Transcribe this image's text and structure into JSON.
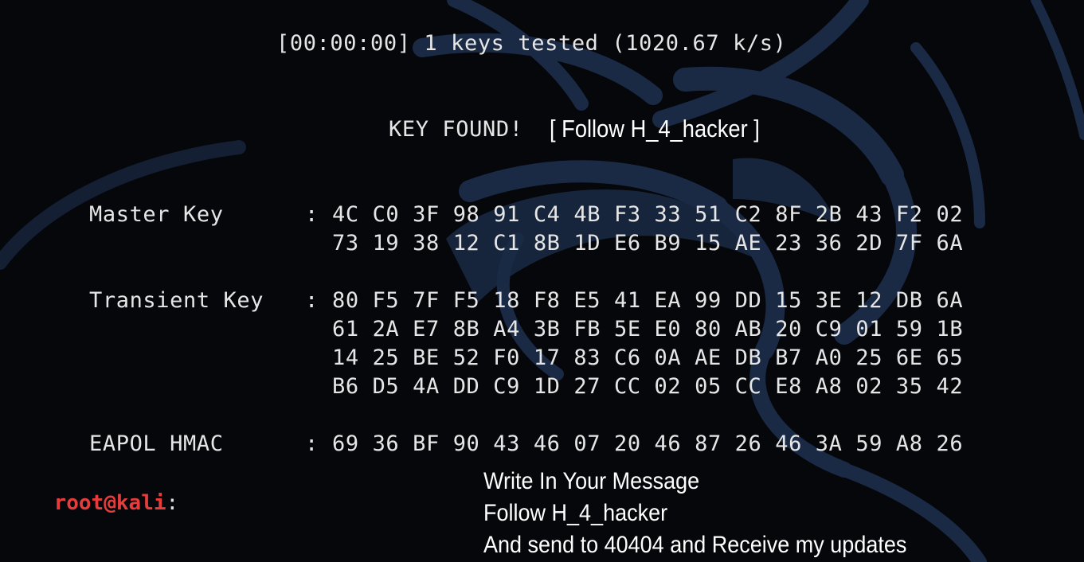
{
  "status_line": "[00:00:00] 1 keys tested (1020.67 k/s)",
  "key_found_label": "KEY FOUND!",
  "overlay_follow": "[ Follow H_4_hacker ]",
  "keys": [
    {
      "label": "Master Key",
      "colon": ":",
      "rows": [
        "4C C0 3F 98 91 C4 4B F3 33 51 C2 8F 2B 43 F2 02",
        "73 19 38 12 C1 8B 1D E6 B9 15 AE 23 36 2D 7F 6A"
      ]
    },
    {
      "label": "Transient Key",
      "colon": ":",
      "rows": [
        "80 F5 7F F5 18 F8 E5 41 EA 99 DD 15 3E 12 DB 6A",
        "61 2A E7 8B A4 3B FB 5E E0 80 AB 20 C9 01 59 1B",
        "14 25 BE 52 F0 17 83 C6 0A AE DB B7 A0 25 6E 65",
        "B6 D5 4A DD C9 1D 27 CC 02 05 CC E8 A8 02 35 42"
      ]
    },
    {
      "label": "EAPOL HMAC",
      "colon": ":",
      "rows": [
        "69 36 BF 90 43 46 07 20 46 87 26 46 3A 59 A8 26"
      ]
    }
  ],
  "prompt": {
    "user_host": "root@kali",
    "separator": ":"
  },
  "caption": [
    "Write In Your Message",
    "Follow H_4_hacker",
    "And send to 40404 and Receive my updates"
  ],
  "colors": {
    "background": "#05070b",
    "text": "#e6e6e6",
    "prompt_user": "#e63c3c",
    "dragon_watermark": "#1a2a45"
  }
}
